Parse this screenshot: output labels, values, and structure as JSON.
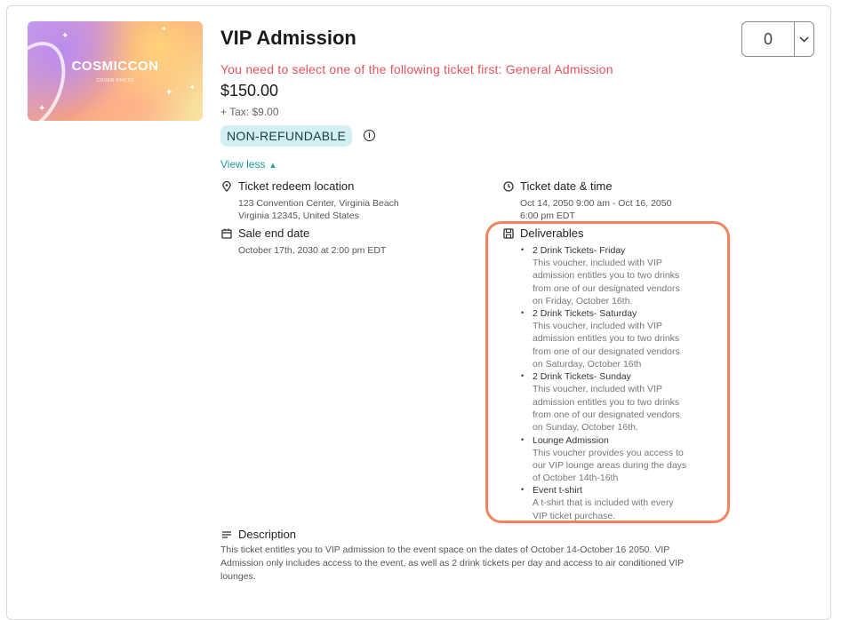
{
  "ticket": {
    "image": {
      "brand": "COSMICCON",
      "subtitle": "COVER PHOTO"
    },
    "title": "VIP Admission",
    "warning": "You need to select one of the following ticket first: General Admission",
    "price": "$150.00",
    "tax": "+ Tax: $9.00",
    "badge": "NON-REFUNDABLE",
    "view_less": "View less",
    "quantity": "0"
  },
  "details": {
    "redeem": {
      "heading": "Ticket redeem location",
      "line1": "123 Convention Center, Virginia Beach",
      "line2": "Virginia 12345, United States"
    },
    "datetime": {
      "heading": "Ticket date & time",
      "line1": "Oct 14, 2050 9:00 am - Oct 16, 2050",
      "line2": "6:00 pm EDT"
    },
    "sale_end": {
      "heading": "Sale end date",
      "line1": "October 17th, 2030 at 2:00 pm EDT"
    },
    "deliverables": {
      "heading": "Deliverables",
      "items": [
        {
          "name": "2 Drink Tickets- Friday",
          "desc": [
            "This voucher, included with VIP",
            "admission entitles you to two drinks",
            "from one of our designated vendors",
            "on Friday, October 16th."
          ]
        },
        {
          "name": "2 Drink Tickets- Saturday",
          "desc": [
            "This voucher, included with VIP",
            "admission entitles you to two drinks",
            "from one of our designated vendors",
            "on Saturday, October 16th"
          ]
        },
        {
          "name": "2 Drink Tickets- Sunday",
          "desc": [
            "This voucher, included with VIP",
            "admission entitles you to two drinks",
            "from one of our designated vendors",
            "on Sunday, October 16th."
          ]
        },
        {
          "name": "Lounge Admission",
          "desc": [
            "This voucher provides you access to",
            "our VIP lounge areas during the days",
            "of October 14th-16th"
          ]
        },
        {
          "name": "Event t-shirt",
          "desc": [
            "A t-shirt that is included with every",
            "VIP ticket purchase."
          ]
        }
      ]
    },
    "description": {
      "heading": "Description",
      "line1": "This ticket entitles you to VIP admission to the event space on the dates of October 14-October 16 2050. VIP",
      "line2": "Admission only includes access to the event, as well as 2 drink tickets per day and access to air conditioned VIP",
      "line3": "lounges."
    }
  },
  "colors": {
    "warning": "#e5535b",
    "accent": "#1d9a9a",
    "badge_bg": "#d4eff1",
    "highlight": "#f0845e"
  },
  "icons": {
    "location": "map-pin-icon",
    "datetime": "clock-icon",
    "sale_end": "calendar-icon",
    "deliverables": "save-icon",
    "description": "lines-icon",
    "info": "info-icon",
    "dropdown": "chevron-down-icon",
    "view_less": "chevron-up-icon"
  }
}
